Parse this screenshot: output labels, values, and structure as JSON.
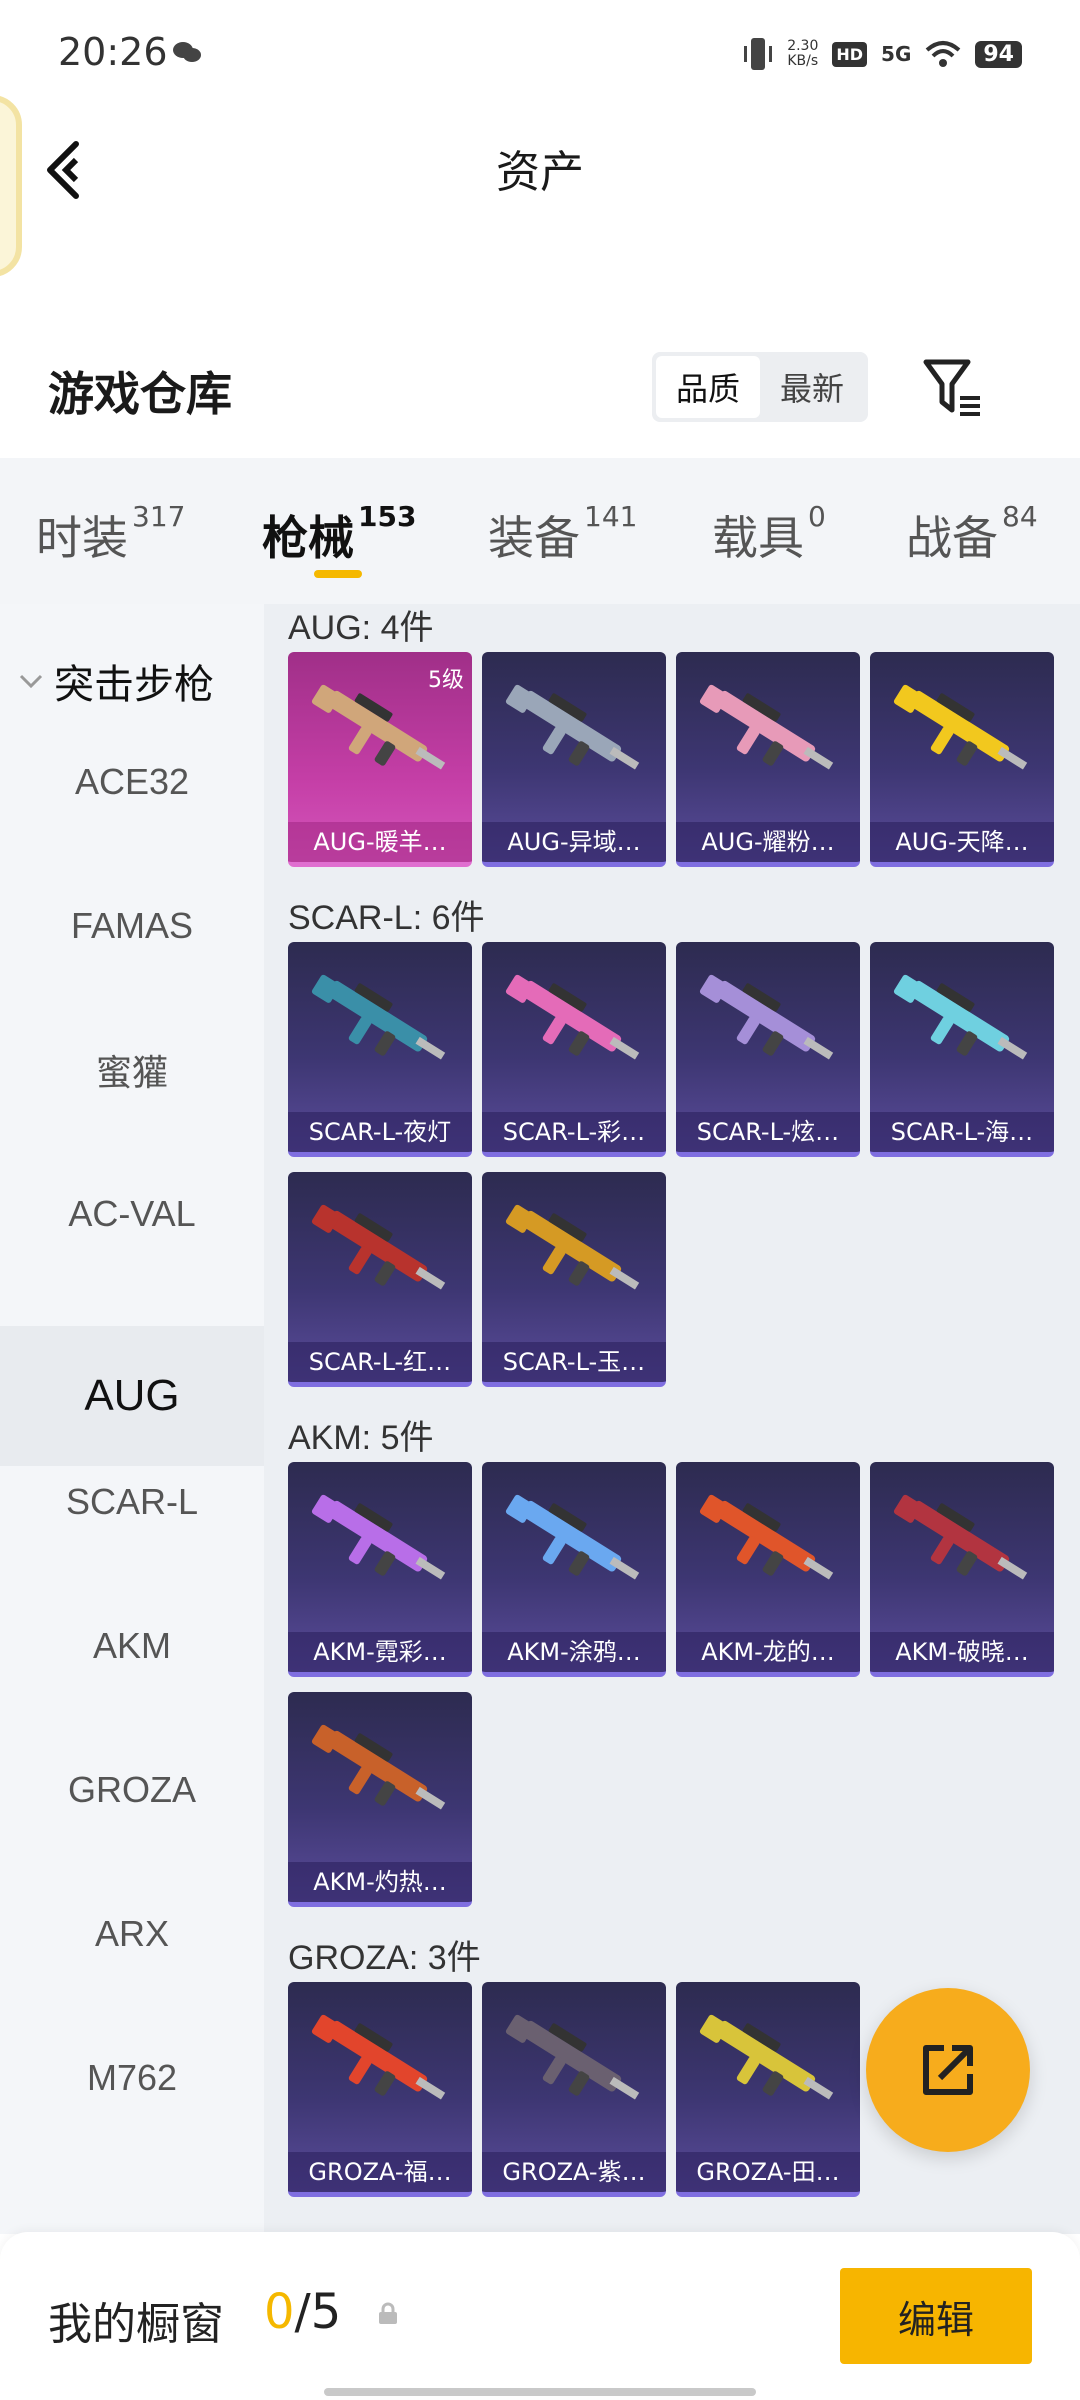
{
  "status": {
    "time": "20:26",
    "net_speed": "2.30",
    "net_unit": "KB/s",
    "hd": "HD",
    "signal": "5G",
    "battery": "94"
  },
  "header": {
    "title": "资产"
  },
  "warehouse": {
    "title": "游戏仓库",
    "sort_options": [
      "品质",
      "最新"
    ],
    "active_sort": "品质"
  },
  "tabs": [
    {
      "label": "时装",
      "count": "317"
    },
    {
      "label": "枪械",
      "count": "153",
      "active": true
    },
    {
      "label": "装备",
      "count": "141"
    },
    {
      "label": "载具",
      "count": "0"
    },
    {
      "label": "战备",
      "count": "84"
    }
  ],
  "sidebar": {
    "group": "突击步枪",
    "items": [
      "ACE32",
      "FAMAS",
      "蜜獾",
      "AC-VAL",
      "AUG",
      "SCAR-L",
      "AKM",
      "GROZA",
      "ARX",
      "M762"
    ],
    "active": "AUG"
  },
  "sections": [
    {
      "title": "AUG: 4件",
      "items": [
        {
          "name": "AUG-暖羊…",
          "level": "5级",
          "color": "#d0a67a"
        },
        {
          "name": "AUG-异域…",
          "color": "#9aa6b8"
        },
        {
          "name": "AUG-耀粉…",
          "color": "#e79ab8"
        },
        {
          "name": "AUG-天降…",
          "color": "#f2c81e"
        }
      ]
    },
    {
      "title": "SCAR-L: 6件",
      "items": [
        {
          "name": "SCAR-L-夜灯",
          "color": "#3a8fa8"
        },
        {
          "name": "SCAR-L-彩…",
          "color": "#e46bb8"
        },
        {
          "name": "SCAR-L-炫…",
          "color": "#a58fd8"
        },
        {
          "name": "SCAR-L-海…",
          "color": "#6fd0e0"
        },
        {
          "name": "SCAR-L-红…",
          "color": "#b8332d"
        },
        {
          "name": "SCAR-L-玉…",
          "color": "#d59a24"
        }
      ]
    },
    {
      "title": "AKM: 5件",
      "items": [
        {
          "name": "AKM-霓彩…",
          "color": "#b86ee8"
        },
        {
          "name": "AKM-涂鸦…",
          "color": "#6aa8f0"
        },
        {
          "name": "AKM-龙的…",
          "color": "#e0552a"
        },
        {
          "name": "AKM-破晓…",
          "color": "#b23440"
        },
        {
          "name": "AKM-灼热…",
          "color": "#c8612a"
        }
      ]
    },
    {
      "title": "GROZA: 3件",
      "items": [
        {
          "name": "GROZA-福…",
          "color": "#e2452c"
        },
        {
          "name": "GROZA-紫…",
          "color": "#6a6070"
        },
        {
          "name": "GROZA-田…",
          "color": "#d8c43a"
        }
      ]
    }
  ],
  "bottom": {
    "label": "我的橱窗",
    "current": "0",
    "total": "/5",
    "edit": "编辑"
  }
}
